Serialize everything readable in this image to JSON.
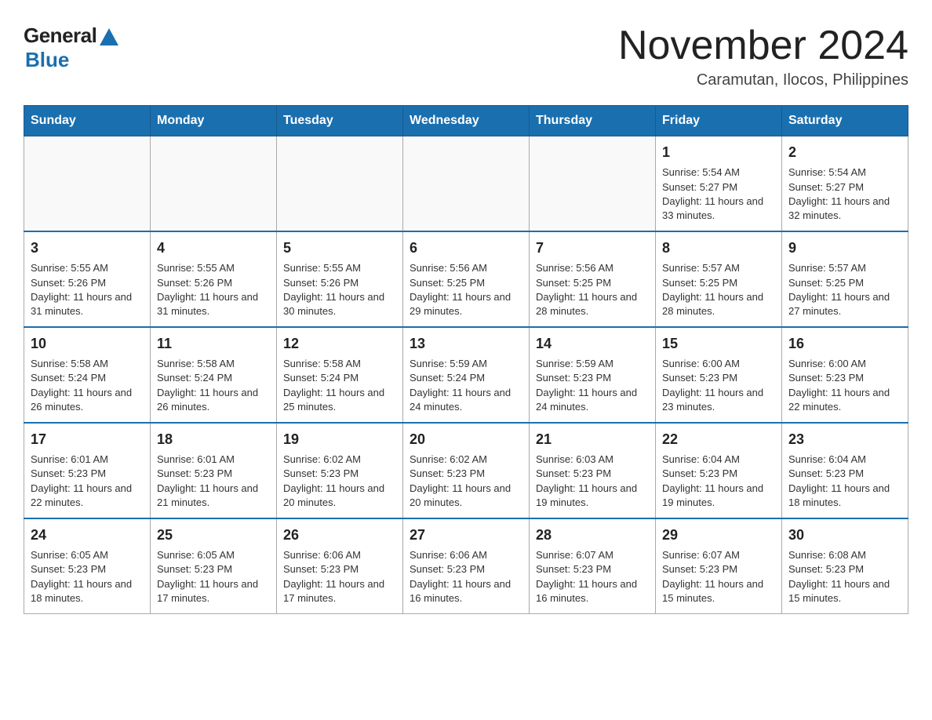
{
  "logo": {
    "general": "General",
    "blue": "Blue"
  },
  "title": "November 2024",
  "subtitle": "Caramutan, Ilocos, Philippines",
  "days_of_week": [
    "Sunday",
    "Monday",
    "Tuesday",
    "Wednesday",
    "Thursday",
    "Friday",
    "Saturday"
  ],
  "weeks": [
    [
      {
        "day": "",
        "info": ""
      },
      {
        "day": "",
        "info": ""
      },
      {
        "day": "",
        "info": ""
      },
      {
        "day": "",
        "info": ""
      },
      {
        "day": "",
        "info": ""
      },
      {
        "day": "1",
        "info": "Sunrise: 5:54 AM\nSunset: 5:27 PM\nDaylight: 11 hours and 33 minutes."
      },
      {
        "day": "2",
        "info": "Sunrise: 5:54 AM\nSunset: 5:27 PM\nDaylight: 11 hours and 32 minutes."
      }
    ],
    [
      {
        "day": "3",
        "info": "Sunrise: 5:55 AM\nSunset: 5:26 PM\nDaylight: 11 hours and 31 minutes."
      },
      {
        "day": "4",
        "info": "Sunrise: 5:55 AM\nSunset: 5:26 PM\nDaylight: 11 hours and 31 minutes."
      },
      {
        "day": "5",
        "info": "Sunrise: 5:55 AM\nSunset: 5:26 PM\nDaylight: 11 hours and 30 minutes."
      },
      {
        "day": "6",
        "info": "Sunrise: 5:56 AM\nSunset: 5:25 PM\nDaylight: 11 hours and 29 minutes."
      },
      {
        "day": "7",
        "info": "Sunrise: 5:56 AM\nSunset: 5:25 PM\nDaylight: 11 hours and 28 minutes."
      },
      {
        "day": "8",
        "info": "Sunrise: 5:57 AM\nSunset: 5:25 PM\nDaylight: 11 hours and 28 minutes."
      },
      {
        "day": "9",
        "info": "Sunrise: 5:57 AM\nSunset: 5:25 PM\nDaylight: 11 hours and 27 minutes."
      }
    ],
    [
      {
        "day": "10",
        "info": "Sunrise: 5:58 AM\nSunset: 5:24 PM\nDaylight: 11 hours and 26 minutes."
      },
      {
        "day": "11",
        "info": "Sunrise: 5:58 AM\nSunset: 5:24 PM\nDaylight: 11 hours and 26 minutes."
      },
      {
        "day": "12",
        "info": "Sunrise: 5:58 AM\nSunset: 5:24 PM\nDaylight: 11 hours and 25 minutes."
      },
      {
        "day": "13",
        "info": "Sunrise: 5:59 AM\nSunset: 5:24 PM\nDaylight: 11 hours and 24 minutes."
      },
      {
        "day": "14",
        "info": "Sunrise: 5:59 AM\nSunset: 5:23 PM\nDaylight: 11 hours and 24 minutes."
      },
      {
        "day": "15",
        "info": "Sunrise: 6:00 AM\nSunset: 5:23 PM\nDaylight: 11 hours and 23 minutes."
      },
      {
        "day": "16",
        "info": "Sunrise: 6:00 AM\nSunset: 5:23 PM\nDaylight: 11 hours and 22 minutes."
      }
    ],
    [
      {
        "day": "17",
        "info": "Sunrise: 6:01 AM\nSunset: 5:23 PM\nDaylight: 11 hours and 22 minutes."
      },
      {
        "day": "18",
        "info": "Sunrise: 6:01 AM\nSunset: 5:23 PM\nDaylight: 11 hours and 21 minutes."
      },
      {
        "day": "19",
        "info": "Sunrise: 6:02 AM\nSunset: 5:23 PM\nDaylight: 11 hours and 20 minutes."
      },
      {
        "day": "20",
        "info": "Sunrise: 6:02 AM\nSunset: 5:23 PM\nDaylight: 11 hours and 20 minutes."
      },
      {
        "day": "21",
        "info": "Sunrise: 6:03 AM\nSunset: 5:23 PM\nDaylight: 11 hours and 19 minutes."
      },
      {
        "day": "22",
        "info": "Sunrise: 6:04 AM\nSunset: 5:23 PM\nDaylight: 11 hours and 19 minutes."
      },
      {
        "day": "23",
        "info": "Sunrise: 6:04 AM\nSunset: 5:23 PM\nDaylight: 11 hours and 18 minutes."
      }
    ],
    [
      {
        "day": "24",
        "info": "Sunrise: 6:05 AM\nSunset: 5:23 PM\nDaylight: 11 hours and 18 minutes."
      },
      {
        "day": "25",
        "info": "Sunrise: 6:05 AM\nSunset: 5:23 PM\nDaylight: 11 hours and 17 minutes."
      },
      {
        "day": "26",
        "info": "Sunrise: 6:06 AM\nSunset: 5:23 PM\nDaylight: 11 hours and 17 minutes."
      },
      {
        "day": "27",
        "info": "Sunrise: 6:06 AM\nSunset: 5:23 PM\nDaylight: 11 hours and 16 minutes."
      },
      {
        "day": "28",
        "info": "Sunrise: 6:07 AM\nSunset: 5:23 PM\nDaylight: 11 hours and 16 minutes."
      },
      {
        "day": "29",
        "info": "Sunrise: 6:07 AM\nSunset: 5:23 PM\nDaylight: 11 hours and 15 minutes."
      },
      {
        "day": "30",
        "info": "Sunrise: 6:08 AM\nSunset: 5:23 PM\nDaylight: 11 hours and 15 minutes."
      }
    ]
  ]
}
